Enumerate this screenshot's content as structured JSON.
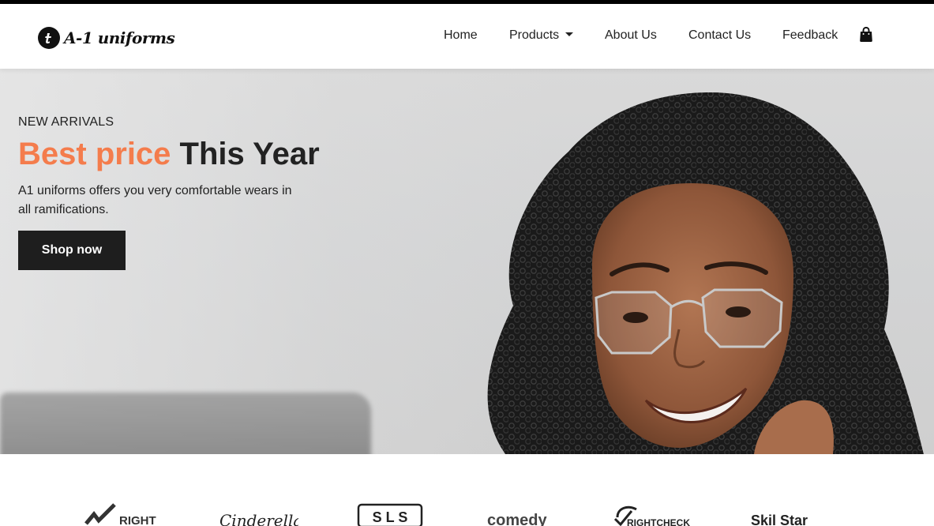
{
  "header": {
    "brand_name": "A-1 uniforms",
    "nav": {
      "home": "Home",
      "products": "Products",
      "about": "About Us",
      "contact": "Contact Us",
      "feedback": "Feedback"
    },
    "cart_icon": "shopping-bag-icon"
  },
  "hero": {
    "eyebrow": "NEW ARRIVALS",
    "headline_accent": "Best price",
    "headline_rest": "This Year",
    "subtext": "A1 uniforms offers you very comfortable wears in all ramifications.",
    "cta_label": "Shop now",
    "accent_color": "#f47c4c"
  },
  "partners": {
    "logos": [
      "RIGHT",
      "Cinderella",
      "S L S",
      "comedy",
      "RIGHTCHECK",
      "Skil Star"
    ]
  }
}
